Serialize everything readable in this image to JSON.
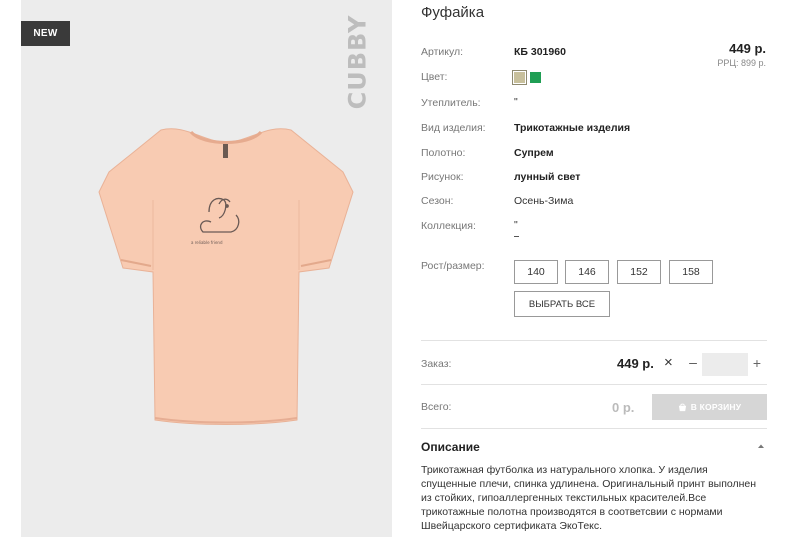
{
  "badge": "NEW",
  "brand": "CUBBY",
  "product": {
    "title": "Фуфайка",
    "price": "449 р.",
    "rrc": "РРЦ: 899 р."
  },
  "colors": {
    "label": "Цвет:",
    "swatches": [
      "#c8c09c",
      "#1f9e54"
    ]
  },
  "specs": [
    {
      "label": "Артикул:",
      "value": "КБ 301960"
    },
    {
      "label": "Утеплитель:",
      "value": "\""
    },
    {
      "label": "Вид изделия:",
      "value": "Трикотажные изделия"
    },
    {
      "label": "Полотно:",
      "value": "Супрем"
    },
    {
      "label": "Рисунок:",
      "value": "лунный свет"
    },
    {
      "label": "Сезон:",
      "value": "Осень-Зима"
    },
    {
      "label": "Коллекция:",
      "value": "\""
    }
  ],
  "sizes": {
    "label": "Рост/размер:",
    "options": [
      "140",
      "146",
      "152",
      "158"
    ],
    "select_all": "ВЫБРАТЬ ВСЕ"
  },
  "order": {
    "label": "Заказ:",
    "price": "449 р.",
    "times": "×",
    "minus": "–",
    "plus": "+",
    "quantity": ""
  },
  "total": {
    "label": "Всего:",
    "value": "0 р.",
    "cart_button": "В КОРЗИНУ"
  },
  "description": {
    "title": "Описание",
    "text": "Трикотажная футболка из натурального хлопка. У изделия спущенные плечи, спинка удлинена. Оригинальный принт выполнен из стойких, гипоаллергенных текстильных красителей.Все трикотажные полотна производятся в соответсвии с нормами Швейцарского сертификата ЭкоТекс."
  },
  "print_text": "a reliable friend"
}
